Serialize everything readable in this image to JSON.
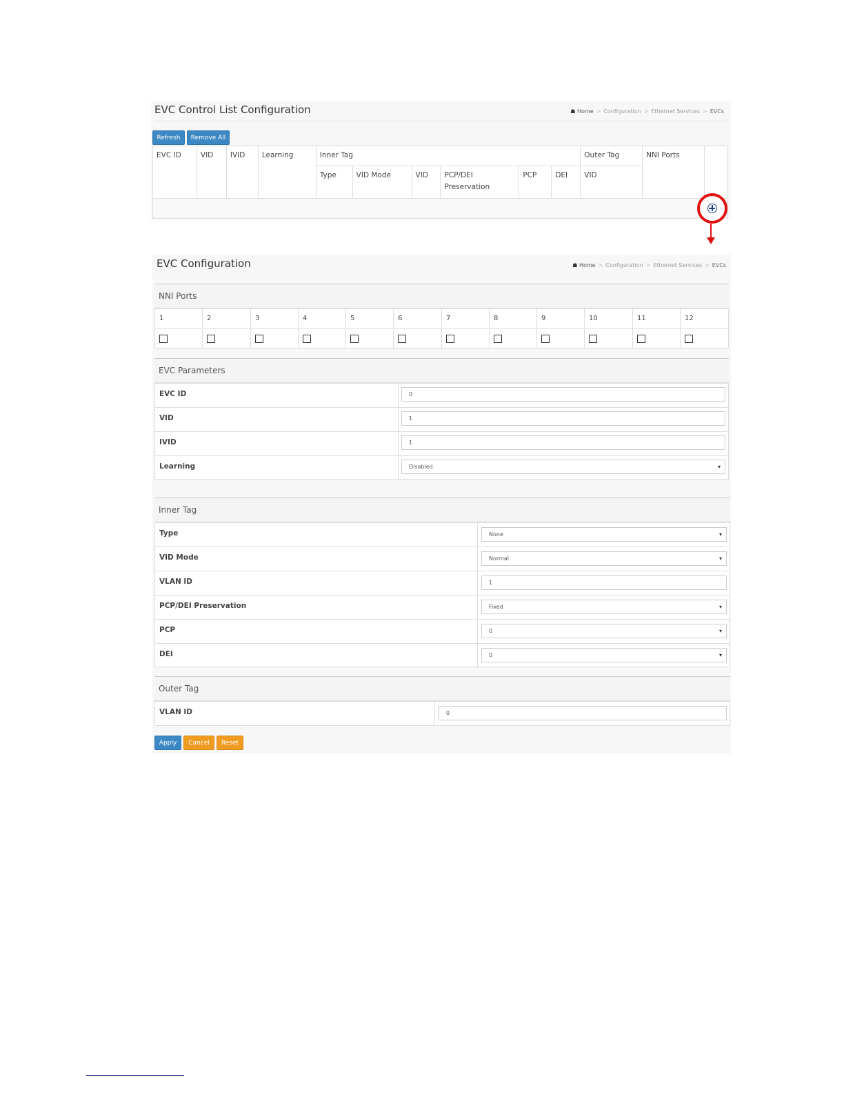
{
  "breadcrumb": {
    "home": "Home",
    "level1": "Configuration",
    "level2": "Ethernet Services",
    "level3": "EVCs"
  },
  "list_page": {
    "title": "EVC Control List Configuration",
    "buttons": {
      "refresh": "Refresh",
      "remove_all": "Remove All"
    },
    "headers": {
      "evc_id": "EVC ID",
      "vid": "VID",
      "ivid": "IVID",
      "learning": "Learning",
      "inner_tag": "Inner Tag",
      "outer_tag": "Outer Tag",
      "nni_ports": "NNI Ports"
    },
    "subheaders": {
      "type": "Type",
      "vid_mode": "VID Mode",
      "vid": "VID",
      "pcp_dei": "PCP/DEI Preservation",
      "pcp": "PCP",
      "dei": "DEI",
      "outer_vid": "VID"
    }
  },
  "config_page": {
    "title": "EVC Configuration",
    "nni": {
      "heading": "NNI Ports",
      "ports": [
        "1",
        "2",
        "3",
        "4",
        "5",
        "6",
        "7",
        "8",
        "9",
        "10",
        "11",
        "12"
      ]
    },
    "params": {
      "heading": "EVC Parameters",
      "evc_id_label": "EVC ID",
      "evc_id_value": "0",
      "vid_label": "VID",
      "vid_value": "1",
      "ivid_label": "IVID",
      "ivid_value": "1",
      "learning_label": "Learning",
      "learning_value": "Disabled"
    },
    "inner": {
      "heading": "Inner Tag",
      "type_label": "Type",
      "type_value": "None",
      "vid_mode_label": "VID Mode",
      "vid_mode_value": "Normal",
      "vlan_label": "VLAN ID",
      "vlan_value": "1",
      "pcp_dei_label": "PCP/DEI Preservation",
      "pcp_dei_value": "Fixed",
      "pcp_label": "PCP",
      "pcp_value": "0",
      "dei_label": "DEI",
      "dei_value": "0"
    },
    "outer": {
      "heading": "Outer Tag",
      "vlan_label": "VLAN ID",
      "vlan_value": "0"
    },
    "buttons": {
      "apply": "Apply",
      "cancel": "Cancel",
      "reset": "Reset"
    }
  },
  "colors": {
    "primary": "#3c88c4",
    "warning": "#f09b22",
    "highlight": "#e01010",
    "icon": "#1f3f8f"
  }
}
